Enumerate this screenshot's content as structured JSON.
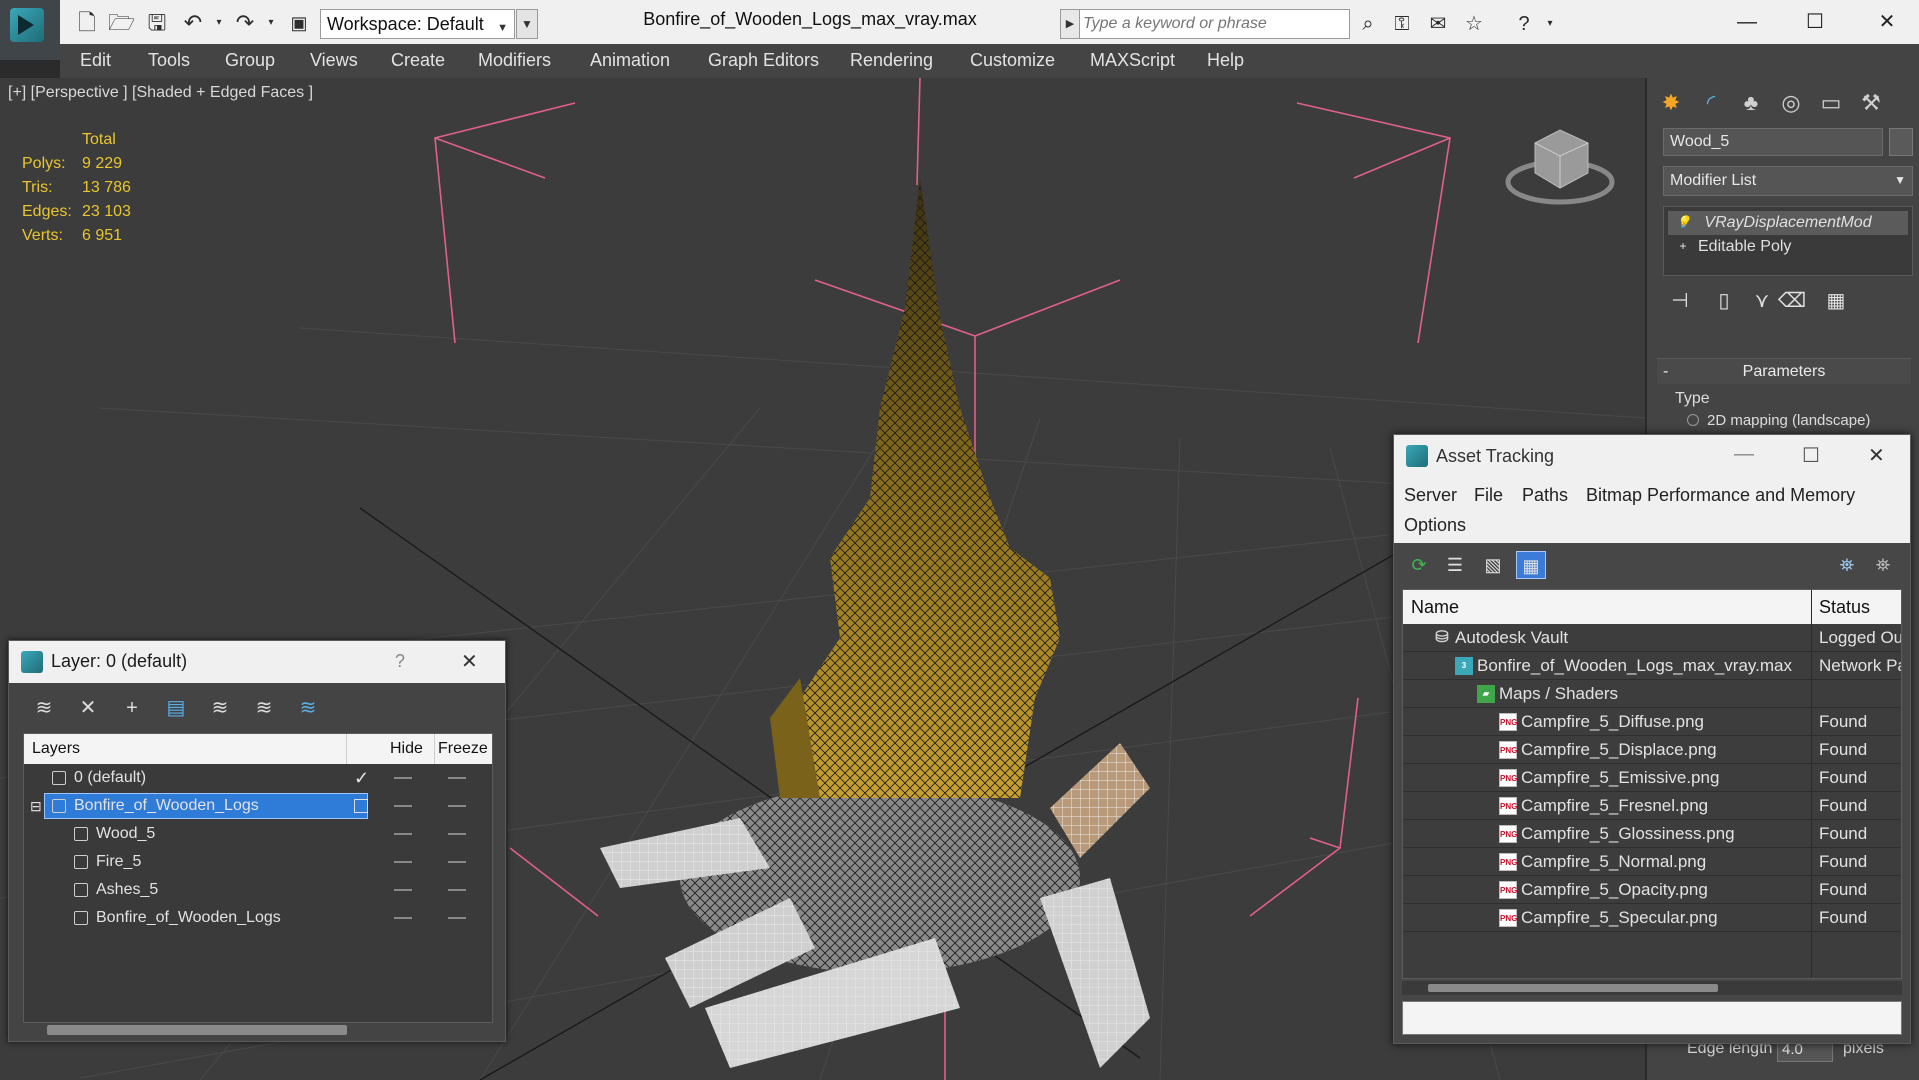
{
  "window": {
    "title": "Bonfire_of_Wooden_Logs_max_vray.max",
    "workspace": "Workspace: Default",
    "search_placeholder": "Type a keyword or phrase",
    "minimize": "—",
    "maximize": "☐",
    "close": "✕"
  },
  "menu": [
    "Edit",
    "Tools",
    "Group",
    "Views",
    "Create",
    "Modifiers",
    "Animation",
    "Graph Editors",
    "Rendering",
    "Customize",
    "MAXScript",
    "Help"
  ],
  "viewport": {
    "label": "[+] [Perspective ] [Shaded + Edged Faces ]",
    "stats": {
      "header": "Total",
      "rows": [
        {
          "key": "Polys:",
          "value": "9 229"
        },
        {
          "key": "Tris:",
          "value": "13 786"
        },
        {
          "key": "Edges:",
          "value": "23 103"
        },
        {
          "key": "Verts:",
          "value": "6 951"
        }
      ]
    }
  },
  "command_panel": {
    "object_name": "Wood_5",
    "modifier_list": "Modifier List",
    "stack": [
      "VRayDisplacementMod",
      "Editable Poly"
    ],
    "params_title": "Parameters",
    "params_collapse": "-",
    "type_label": "Type",
    "mapping_option": "2D mapping (landscape)",
    "edge_length_label": "Edge length",
    "edge_length_value": "4.0",
    "edge_length_unit": "pixels"
  },
  "layer_dialog": {
    "title": "Layer: 0 (default)",
    "help": "?",
    "close": "✕",
    "columns": {
      "layers": "Layers",
      "hide": "Hide",
      "freeze": "Freeze"
    },
    "rows": [
      {
        "name": "0 (default)",
        "indent": 1,
        "current": "✓"
      },
      {
        "name": "Bonfire_of_Wooden_Logs",
        "indent": 1,
        "selected": true
      },
      {
        "name": "Wood_5",
        "indent": 2
      },
      {
        "name": "Fire_5",
        "indent": 2
      },
      {
        "name": "Ashes_5",
        "indent": 2
      },
      {
        "name": "Bonfire_of_Wooden_Logs",
        "indent": 2
      }
    ]
  },
  "asset_dialog": {
    "title": "Asset Tracking",
    "menu_row1": [
      "Server",
      "File",
      "Paths",
      "Bitmap Performance and Memory"
    ],
    "menu_row2": [
      "Options"
    ],
    "columns": {
      "name": "Name",
      "status": "Status"
    },
    "rows": [
      {
        "name": "Autodesk Vault",
        "status": "Logged Ou",
        "icon": "vault-icon",
        "indent": 1
      },
      {
        "name": "Bonfire_of_Wooden_Logs_max_vray.max",
        "status": "Network Pa",
        "icon": "max-file-icon",
        "indent": 2
      },
      {
        "name": "Maps / Shaders",
        "status": "",
        "icon": "folder-icon",
        "indent": 3
      },
      {
        "name": "Campfire_5_Diffuse.png",
        "status": "Found",
        "icon": "png-icon",
        "indent": 4
      },
      {
        "name": "Campfire_5_Displace.png",
        "status": "Found",
        "icon": "png-icon",
        "indent": 4
      },
      {
        "name": "Campfire_5_Emissive.png",
        "status": "Found",
        "icon": "png-icon",
        "indent": 4
      },
      {
        "name": "Campfire_5_Fresnel.png",
        "status": "Found",
        "icon": "png-icon",
        "indent": 4
      },
      {
        "name": "Campfire_5_Glossiness.png",
        "status": "Found",
        "icon": "png-icon",
        "indent": 4
      },
      {
        "name": "Campfire_5_Normal.png",
        "status": "Found",
        "icon": "png-icon",
        "indent": 4
      },
      {
        "name": "Campfire_5_Opacity.png",
        "status": "Found",
        "icon": "png-icon",
        "indent": 4
      },
      {
        "name": "Campfire_5_Specular.png",
        "status": "Found",
        "icon": "png-icon",
        "indent": 4
      }
    ],
    "png_badge": "PNG",
    "max_badge": "3"
  },
  "colors": {
    "accent_blue": "#2f7bd8",
    "stats_yellow": "#e8c630",
    "gizmo_pink": "#e0608a",
    "fire_dark": "#5a4a10",
    "fire_light": "#c9a030"
  }
}
